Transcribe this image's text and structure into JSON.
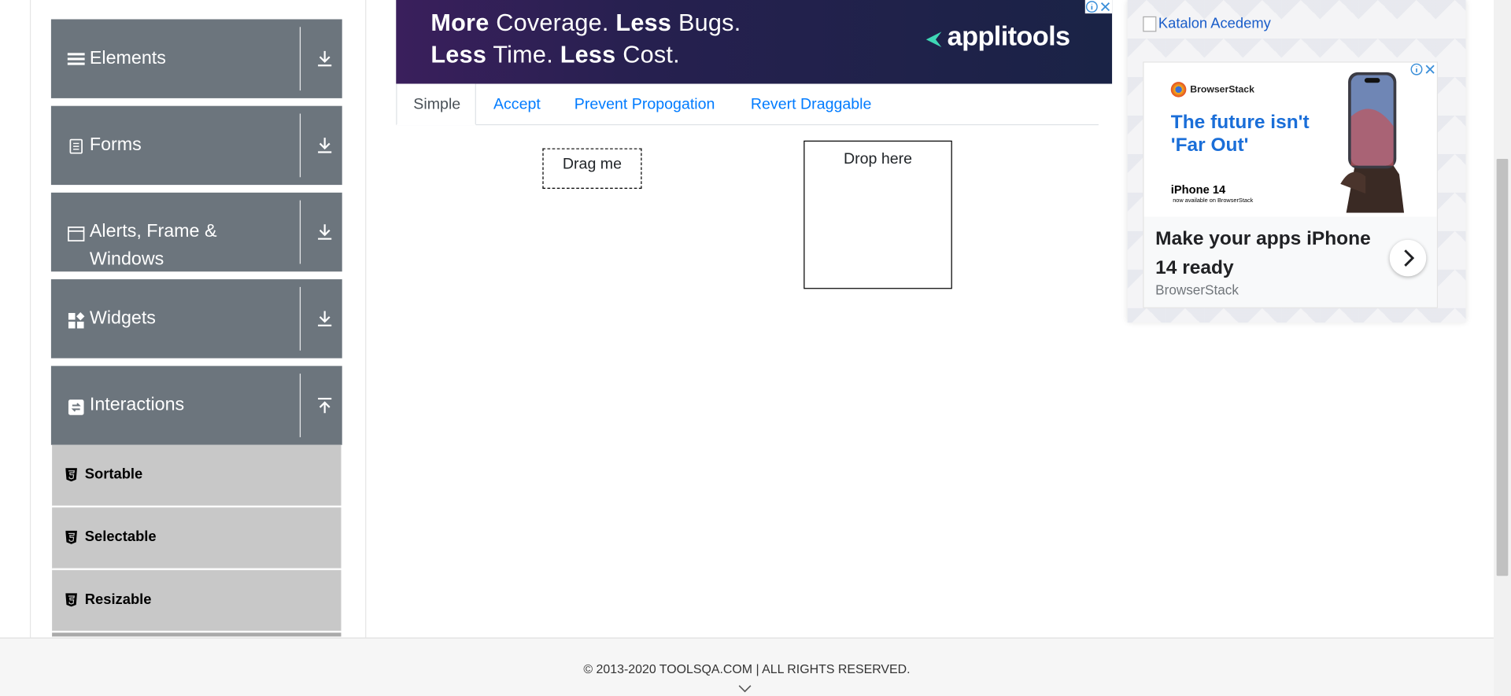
{
  "sidebar": {
    "groups": [
      {
        "label": "Elements",
        "icon": "hamburger-icon",
        "expanded": false
      },
      {
        "label": "Forms",
        "icon": "document-icon",
        "expanded": false
      },
      {
        "label_line1": "Alerts, Frame &",
        "label_line2": "Windows",
        "icon": "window-icon",
        "expanded": false
      },
      {
        "label": "Widgets",
        "icon": "widgets-icon",
        "expanded": false
      },
      {
        "label": "Interactions",
        "icon": "interactions-icon",
        "expanded": true
      }
    ],
    "items": [
      {
        "label": "Sortable",
        "icon": "html5-icon"
      },
      {
        "label": "Selectable",
        "icon": "html5-icon"
      },
      {
        "label": "Resizable",
        "icon": "html5-icon"
      }
    ]
  },
  "top_ad": {
    "line1_bold_a": "More",
    "line1_rest_a": " Coverage. ",
    "line1_bold_b": "Less",
    "line1_rest_b": " Bugs.",
    "line2_bold_a": "Less",
    "line2_rest_a": " Time. ",
    "line2_bold_b": "Less",
    "line2_rest_b": " Cost.",
    "brand": "applitools"
  },
  "tabs": [
    {
      "label": "Simple",
      "active": true
    },
    {
      "label": "Accept",
      "active": false
    },
    {
      "label": "Prevent Propogation",
      "active": false
    },
    {
      "label": "Revert Draggable",
      "active": false
    }
  ],
  "draggable": {
    "label": "Drag me"
  },
  "droppable": {
    "label": "Drop here"
  },
  "right_ad": {
    "katalon_alt": "Katalon Acedemy",
    "brand": "BrowserStack",
    "headline": "The future isn't 'Far Out'",
    "model": "iPhone 14",
    "model_sub": "now available on BrowserStack",
    "title": "Make your apps iPhone 14 ready",
    "source": "BrowserStack"
  },
  "footer": {
    "copyright": "© 2013-2020 TOOLSQA.COM | ALL RIGHTS RESERVED."
  },
  "colors": {
    "group_bg": "#6c757d",
    "item_bg": "#c8c8c8",
    "link": "#007bff",
    "ad_dark": "#26204f"
  }
}
